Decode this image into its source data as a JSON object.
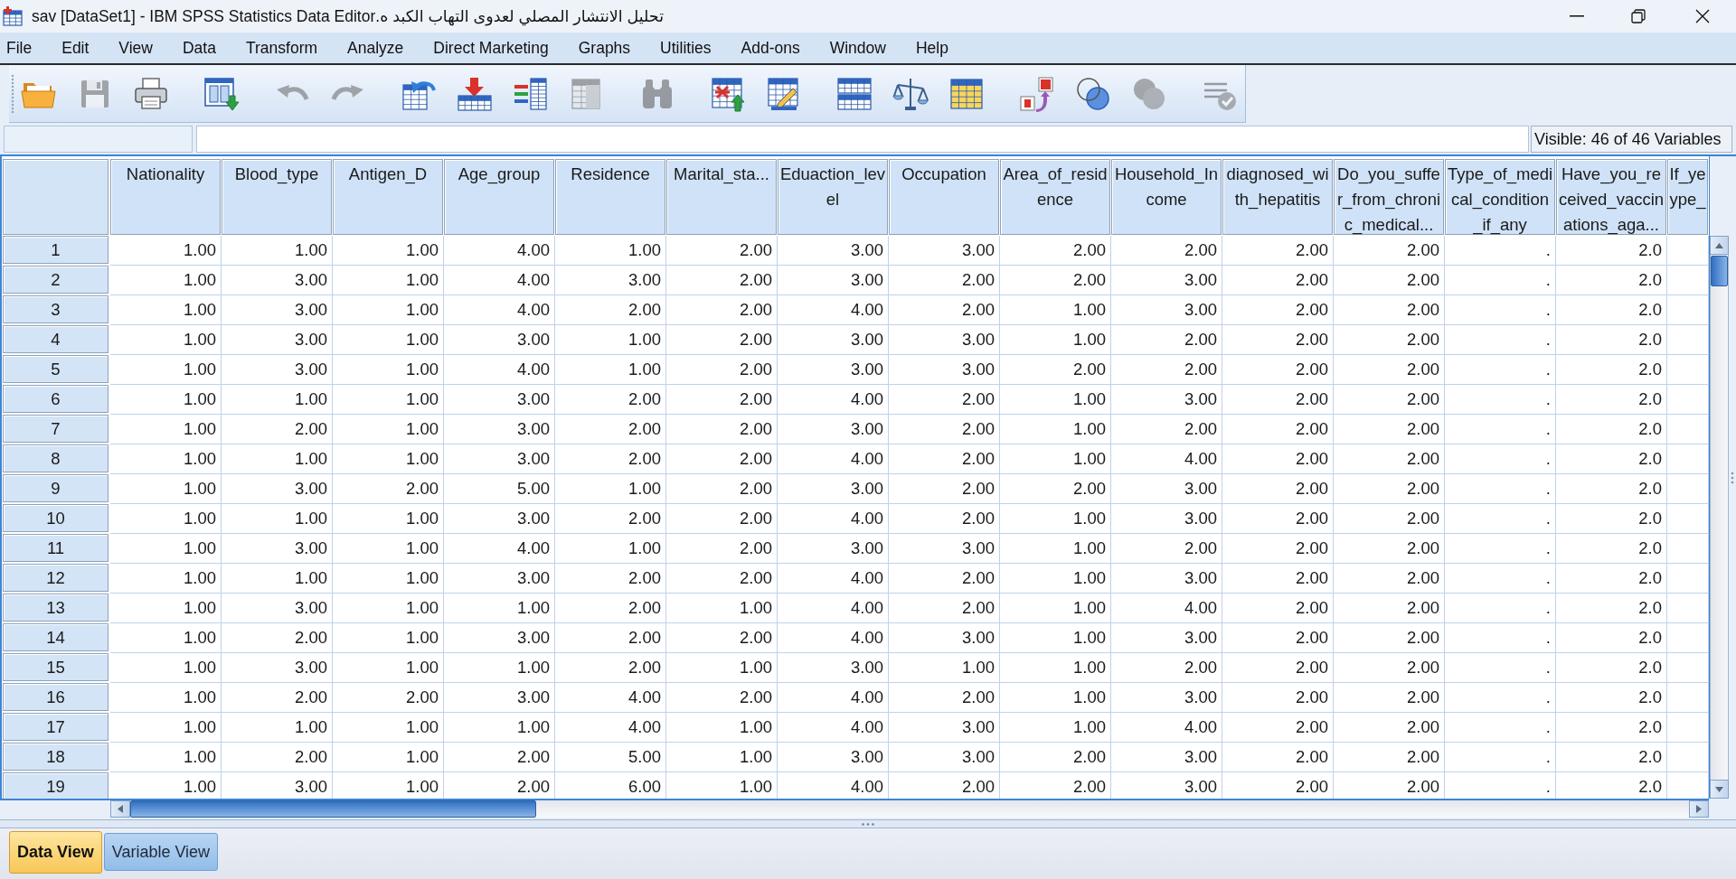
{
  "window": {
    "title": "تحليل الانتشار المصلي لعدوى التهاب الكبد ه.sav [DataSet1] - IBM SPSS Statistics Data Editor"
  },
  "menu": [
    "File",
    "Edit",
    "View",
    "Data",
    "Transform",
    "Analyze",
    "Direct Marketing",
    "Graphs",
    "Utilities",
    "Add-ons",
    "Window",
    "Help"
  ],
  "toolbar": [
    [
      {
        "kind": "open",
        "disabled": false
      },
      {
        "kind": "save",
        "disabled": true
      },
      {
        "kind": "print",
        "disabled": false
      }
    ],
    [
      {
        "kind": "recall",
        "disabled": false
      }
    ],
    [
      {
        "kind": "undo",
        "disabled": true
      },
      {
        "kind": "redo",
        "disabled": true
      }
    ],
    [
      {
        "kind": "goto-case",
        "disabled": false
      },
      {
        "kind": "goto-variable",
        "disabled": false
      },
      {
        "kind": "variables",
        "disabled": false
      },
      {
        "kind": "descriptives",
        "disabled": true
      }
    ],
    [
      {
        "kind": "find",
        "disabled": true
      }
    ],
    [
      {
        "kind": "insert-cases",
        "disabled": false
      },
      {
        "kind": "insert-variable",
        "disabled": false
      }
    ],
    [
      {
        "kind": "split-file",
        "disabled": false
      },
      {
        "kind": "weight-cases",
        "disabled": false
      },
      {
        "kind": "select-cases",
        "disabled": false
      }
    ],
    [
      {
        "kind": "value-labels",
        "disabled": false
      },
      {
        "kind": "variable-sets",
        "disabled": false
      },
      {
        "kind": "show-all",
        "disabled": true
      }
    ],
    [
      {
        "kind": "spell-check",
        "disabled": true
      }
    ]
  ],
  "cell_editor": {
    "status": "Visible: 46 of 46 Variables"
  },
  "data_grid": {
    "columns": [
      {
        "header": [
          "Nationality"
        ]
      },
      {
        "header": [
          "Blood_type"
        ]
      },
      {
        "header": [
          "Antigen_D"
        ]
      },
      {
        "header": [
          "Age_group"
        ]
      },
      {
        "header": [
          "Residence"
        ]
      },
      {
        "header": [
          "Marital_sta..."
        ]
      },
      {
        "header": [
          "Eduaction_lev",
          "el"
        ]
      },
      {
        "header": [
          "Occupation"
        ]
      },
      {
        "header": [
          "Area_of_resid",
          "ence"
        ]
      },
      {
        "header": [
          "Household_In",
          "come"
        ]
      },
      {
        "header": [
          "diagnosed_wi",
          "th_hepatitis"
        ]
      },
      {
        "header": [
          "Do_you_suffe",
          "r_from_chroni",
          "c_medical..."
        ]
      },
      {
        "header": [
          "Type_of_medi",
          "cal_condition",
          "_if_any"
        ]
      },
      {
        "header": [
          "Have_you_re",
          "ceived_vaccin",
          "ations_aga..."
        ]
      },
      {
        "header": [
          "If_ye",
          "ype_"
        ]
      }
    ],
    "rows": [
      {
        "number": "1",
        "cells": [
          "1.00",
          "1.00",
          "1.00",
          "4.00",
          "1.00",
          "2.00",
          "3.00",
          "3.00",
          "2.00",
          "2.00",
          "2.00",
          "2.00",
          ".",
          "2.0"
        ]
      },
      {
        "number": "2",
        "cells": [
          "1.00",
          "3.00",
          "1.00",
          "4.00",
          "3.00",
          "2.00",
          "3.00",
          "2.00",
          "2.00",
          "3.00",
          "2.00",
          "2.00",
          ".",
          "2.0"
        ]
      },
      {
        "number": "3",
        "cells": [
          "1.00",
          "3.00",
          "1.00",
          "4.00",
          "2.00",
          "2.00",
          "4.00",
          "2.00",
          "1.00",
          "3.00",
          "2.00",
          "2.00",
          ".",
          "2.0"
        ]
      },
      {
        "number": "4",
        "cells": [
          "1.00",
          "3.00",
          "1.00",
          "3.00",
          "1.00",
          "2.00",
          "3.00",
          "3.00",
          "1.00",
          "2.00",
          "2.00",
          "2.00",
          ".",
          "2.0"
        ]
      },
      {
        "number": "5",
        "cells": [
          "1.00",
          "3.00",
          "1.00",
          "4.00",
          "1.00",
          "2.00",
          "3.00",
          "3.00",
          "2.00",
          "2.00",
          "2.00",
          "2.00",
          ".",
          "2.0"
        ]
      },
      {
        "number": "6",
        "cells": [
          "1.00",
          "1.00",
          "1.00",
          "3.00",
          "2.00",
          "2.00",
          "4.00",
          "2.00",
          "1.00",
          "3.00",
          "2.00",
          "2.00",
          ".",
          "2.0"
        ]
      },
      {
        "number": "7",
        "cells": [
          "1.00",
          "2.00",
          "1.00",
          "3.00",
          "2.00",
          "2.00",
          "3.00",
          "2.00",
          "1.00",
          "2.00",
          "2.00",
          "2.00",
          ".",
          "2.0"
        ]
      },
      {
        "number": "8",
        "cells": [
          "1.00",
          "1.00",
          "1.00",
          "3.00",
          "2.00",
          "2.00",
          "4.00",
          "2.00",
          "1.00",
          "4.00",
          "2.00",
          "2.00",
          ".",
          "2.0"
        ]
      },
      {
        "number": "9",
        "cells": [
          "1.00",
          "3.00",
          "2.00",
          "5.00",
          "1.00",
          "2.00",
          "3.00",
          "2.00",
          "2.00",
          "3.00",
          "2.00",
          "2.00",
          ".",
          "2.0"
        ]
      },
      {
        "number": "10",
        "cells": [
          "1.00",
          "1.00",
          "1.00",
          "3.00",
          "2.00",
          "2.00",
          "4.00",
          "2.00",
          "1.00",
          "3.00",
          "2.00",
          "2.00",
          ".",
          "2.0"
        ]
      },
      {
        "number": "11",
        "cells": [
          "1.00",
          "3.00",
          "1.00",
          "4.00",
          "1.00",
          "2.00",
          "3.00",
          "3.00",
          "1.00",
          "2.00",
          "2.00",
          "2.00",
          ".",
          "2.0"
        ]
      },
      {
        "number": "12",
        "cells": [
          "1.00",
          "1.00",
          "1.00",
          "3.00",
          "2.00",
          "2.00",
          "4.00",
          "2.00",
          "1.00",
          "3.00",
          "2.00",
          "2.00",
          ".",
          "2.0"
        ]
      },
      {
        "number": "13",
        "cells": [
          "1.00",
          "3.00",
          "1.00",
          "1.00",
          "2.00",
          "1.00",
          "4.00",
          "2.00",
          "1.00",
          "4.00",
          "2.00",
          "2.00",
          ".",
          "2.0"
        ]
      },
      {
        "number": "14",
        "cells": [
          "1.00",
          "2.00",
          "1.00",
          "3.00",
          "2.00",
          "2.00",
          "4.00",
          "3.00",
          "1.00",
          "3.00",
          "2.00",
          "2.00",
          ".",
          "2.0"
        ]
      },
      {
        "number": "15",
        "cells": [
          "1.00",
          "3.00",
          "1.00",
          "1.00",
          "2.00",
          "1.00",
          "3.00",
          "1.00",
          "1.00",
          "2.00",
          "2.00",
          "2.00",
          ".",
          "2.0"
        ]
      },
      {
        "number": "16",
        "cells": [
          "1.00",
          "2.00",
          "2.00",
          "3.00",
          "4.00",
          "2.00",
          "4.00",
          "2.00",
          "1.00",
          "3.00",
          "2.00",
          "2.00",
          ".",
          "2.0"
        ]
      },
      {
        "number": "17",
        "cells": [
          "1.00",
          "1.00",
          "1.00",
          "1.00",
          "4.00",
          "1.00",
          "4.00",
          "3.00",
          "1.00",
          "4.00",
          "2.00",
          "2.00",
          ".",
          "2.0"
        ]
      },
      {
        "number": "18",
        "cells": [
          "1.00",
          "2.00",
          "1.00",
          "2.00",
          "5.00",
          "1.00",
          "3.00",
          "3.00",
          "2.00",
          "3.00",
          "2.00",
          "2.00",
          ".",
          "2.0"
        ]
      },
      {
        "number": "19",
        "cells": [
          "1.00",
          "3.00",
          "1.00",
          "2.00",
          "6.00",
          "1.00",
          "4.00",
          "2.00",
          "2.00",
          "3.00",
          "2.00",
          "2.00",
          ".",
          "2.0"
        ]
      }
    ]
  },
  "tabs": [
    {
      "label": "Data View",
      "selected": true
    },
    {
      "label": "Variable View",
      "selected": false
    }
  ]
}
